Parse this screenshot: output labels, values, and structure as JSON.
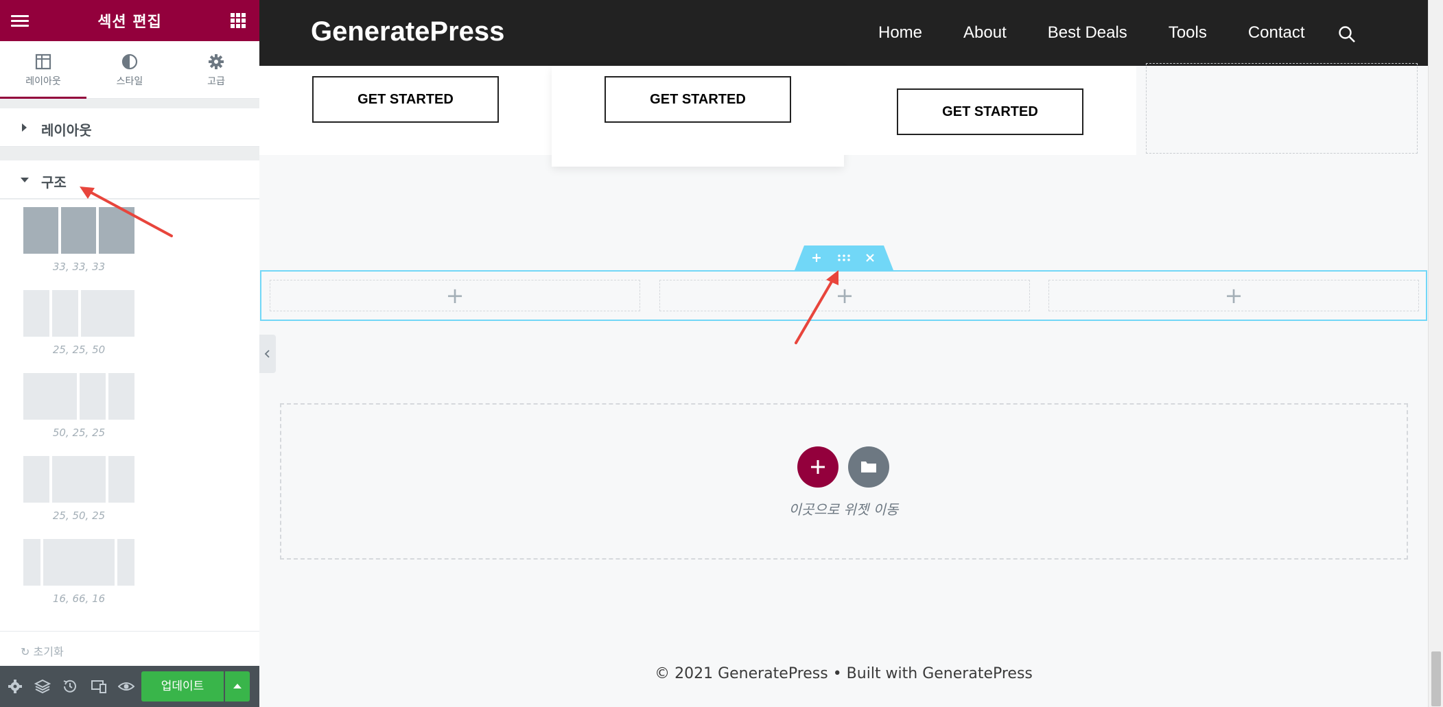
{
  "panel": {
    "title": "섹션 편집",
    "tabs": [
      {
        "label": "레이아웃",
        "icon": "layout-columns-icon"
      },
      {
        "label": "스타일",
        "icon": "contrast-icon"
      },
      {
        "label": "고급",
        "icon": "gear-icon"
      }
    ],
    "sections": {
      "layout_label": "레이아웃",
      "structure_label": "구조"
    },
    "presets": [
      {
        "caption": "33, 33, 33",
        "selected": true
      },
      {
        "caption": "25, 25, 50",
        "selected": false
      },
      {
        "caption": "50, 25, 25",
        "selected": false
      },
      {
        "caption": "25, 50, 25",
        "selected": false
      },
      {
        "caption": "16, 66, 16",
        "selected": false
      }
    ],
    "reset_label": "초기화",
    "footer": {
      "update_label": "업데이트",
      "icons": [
        "settings-icon",
        "navigator-layers-icon",
        "history-icon",
        "responsive-mode-icon",
        "preview-eye-icon"
      ]
    },
    "accent_color": "#93003c",
    "update_color": "#39b54a"
  },
  "site": {
    "logo": "GeneratePress",
    "nav": [
      "Home",
      "About",
      "Best Deals",
      "Tools",
      "Contact"
    ],
    "get_started": [
      "GET STARTED",
      "GET STARTED",
      "GET STARTED"
    ],
    "drop_text": "이곳으로 위젯 이동",
    "footer": "© 2021 GeneratePress • Built with GeneratePress",
    "header_color": "#222222",
    "section_outline_color": "#71d7f7"
  }
}
